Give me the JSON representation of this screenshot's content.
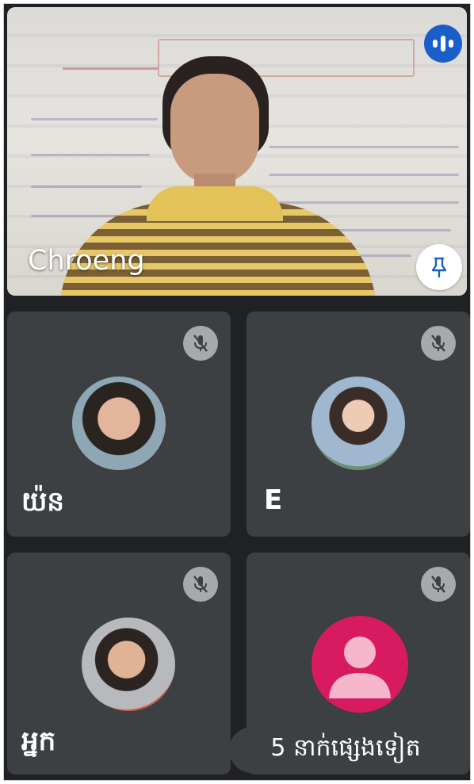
{
  "presenter": {
    "name": "Chroeng",
    "speaking_icon": "audio-level-icon",
    "pin_icon": "pin-icon"
  },
  "participants": [
    {
      "name": "យ៉ន",
      "muted": true,
      "avatar": "photo-avatar"
    },
    {
      "name": "E",
      "muted": true,
      "avatar": "photo-avatar"
    },
    {
      "name": "អ្នក",
      "muted": true,
      "avatar": "photo-avatar"
    },
    {
      "name": "",
      "muted": true,
      "avatar": "default-person-avatar"
    }
  ],
  "more_participants_label": "5 នាក់ផ្សេងទៀត",
  "colors": {
    "background": "#202124",
    "tile": "#3c4043",
    "speaking_accent": "#1a5fc9",
    "default_avatar": "#d81b60"
  }
}
